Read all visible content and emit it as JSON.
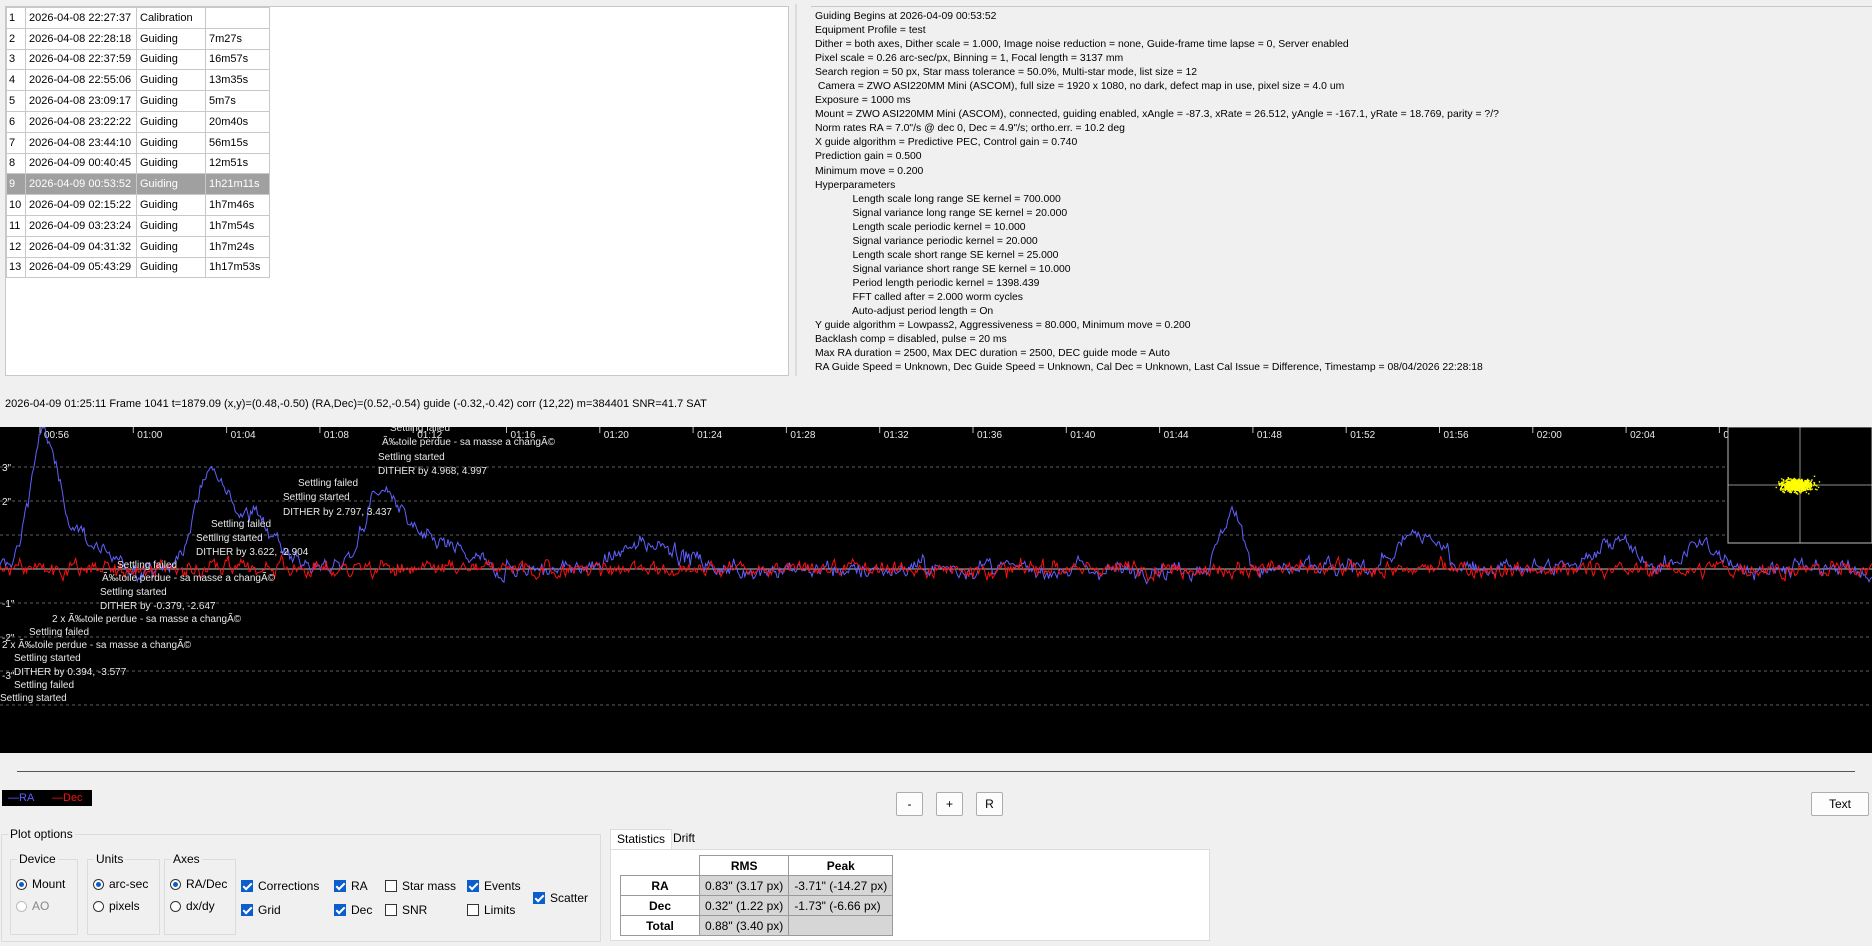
{
  "sessions": [
    {
      "n": "1",
      "date": "2026-04-08 22:27:37",
      "type": "Calibration",
      "dur": ""
    },
    {
      "n": "2",
      "date": "2026-04-08 22:28:18",
      "type": "Guiding",
      "dur": "7m27s"
    },
    {
      "n": "3",
      "date": "2026-04-08 22:37:59",
      "type": "Guiding",
      "dur": "16m57s"
    },
    {
      "n": "4",
      "date": "2026-04-08 22:55:06",
      "type": "Guiding",
      "dur": "13m35s"
    },
    {
      "n": "5",
      "date": "2026-04-08 23:09:17",
      "type": "Guiding",
      "dur": "5m7s"
    },
    {
      "n": "6",
      "date": "2026-04-08 23:22:22",
      "type": "Guiding",
      "dur": "20m40s"
    },
    {
      "n": "7",
      "date": "2026-04-08 23:44:10",
      "type": "Guiding",
      "dur": "56m15s"
    },
    {
      "n": "8",
      "date": "2026-04-09 00:40:45",
      "type": "Guiding",
      "dur": "12m51s"
    },
    {
      "n": "9",
      "date": "2026-04-09 00:53:52",
      "type": "Guiding",
      "dur": "1h21m11s",
      "selected": true
    },
    {
      "n": "10",
      "date": "2026-04-09 02:15:22",
      "type": "Guiding",
      "dur": "1h7m46s"
    },
    {
      "n": "11",
      "date": "2026-04-09 03:23:24",
      "type": "Guiding",
      "dur": "1h7m54s"
    },
    {
      "n": "12",
      "date": "2026-04-09 04:31:32",
      "type": "Guiding",
      "dur": "1h7m24s"
    },
    {
      "n": "13",
      "date": "2026-04-09 05:43:29",
      "type": "Guiding",
      "dur": "1h17m53s"
    }
  ],
  "info_lines": [
    "Guiding Begins at 2026-04-09 00:53:52",
    "Equipment Profile = test",
    "Dither = both axes, Dither scale = 1.000, Image noise reduction = none, Guide-frame time lapse = 0, Server enabled",
    "Pixel scale = 0.26 arc-sec/px, Binning = 1, Focal length = 3137 mm",
    "Search region = 50 px, Star mass tolerance = 50.0%, Multi-star mode, list size = 12",
    " Camera = ZWO ASI220MM Mini (ASCOM), full size = 1920 x 1080, no dark, defect map in use, pixel size = 4.0 um",
    "Exposure = 1000 ms",
    "Mount = ZWO ASI220MM Mini (ASCOM), connected, guiding enabled, xAngle = -87.3, xRate = 26.512, yAngle = -167.1, yRate = 18.769, parity = ?/?",
    "Norm rates RA = 7.0\"/s @ dec 0, Dec = 4.9\"/s; ortho.err. = 10.2 deg",
    "X guide algorithm = Predictive PEC, Control gain = 0.740",
    "Prediction gain = 0.500",
    "Minimum move = 0.200",
    "Hyperparameters",
    "             Length scale long range SE kernel = 700.000",
    "             Signal variance long range SE kernel = 20.000",
    "             Length scale periodic kernel = 10.000",
    "             Signal variance periodic kernel = 20.000",
    "             Length scale short range SE kernel = 25.000",
    "             Signal variance short range SE kernel = 10.000",
    "             Period length periodic kernel = 1398.439",
    "             FFT called after = 2.000 worm cycles",
    "             Auto-adjust period length = On",
    "Y guide algorithm = Lowpass2, Aggressiveness = 80.000, Minimum move = 0.200",
    "Backlash comp = disabled, pulse = 20 ms",
    "Max RA duration = 2500, Max DEC duration = 2500, DEC guide mode = Auto",
    "RA Guide Speed = Unknown, Dec Guide Speed = Unknown, Cal Dec = Unknown, Last Cal Issue = Difference, Timestamp = 08/04/2026 22:28:18"
  ],
  "status_line": "2026-04-09 01:25:11 Frame 1041 t=1879.09 (x,y)=(0.48,-0.50) (RA,Dec)=(0.52,-0.54) guide (-0.32,-0.42) corr (12,22) m=384401 SNR=41.7 SAT",
  "graph": {
    "time_ticks": [
      "00:56",
      "01:00",
      "01:04",
      "01:08",
      "01:12",
      "01:16",
      "01:20",
      "01:24",
      "01:28",
      "01:32",
      "01:36",
      "01:40",
      "01:44",
      "01:48",
      "01:52",
      "01:56",
      "02:00",
      "02:04",
      "0"
    ],
    "y_ticks": [
      "3\"",
      "2\"",
      "-1\"",
      "-2\"",
      "-3\""
    ],
    "events": [
      {
        "text": "Settling failed"
      },
      {
        "text": "Ã‰toile perdue - sa masse a changÃ©"
      },
      {
        "text": "Settling started"
      },
      {
        "text": "DITHER by 4.968, 4.997"
      },
      {
        "text": "Settling failed"
      },
      {
        "text": "Settling started"
      },
      {
        "text": "DITHER by 2.797, 3.437"
      },
      {
        "text": "Settling failed"
      },
      {
        "text": "Settling started"
      },
      {
        "text": "DITHER by 3.622, -2.904"
      },
      {
        "text": "Settling failed"
      },
      {
        "text": "Ã‰toile perdue - sa masse a changÃ©"
      },
      {
        "text": "Settling started"
      },
      {
        "text": "DITHER by -0.379, -2.647"
      },
      {
        "text": "2 x Ã‰toile perdue - sa masse a changÃ©"
      },
      {
        "text": "Settling failed"
      },
      {
        "text": "2 x Ã‰toile perdue - sa masse a changÃ©"
      },
      {
        "text": "Settling started"
      },
      {
        "text": "DITHER by 0.394, -3.577"
      },
      {
        "text": "Settling failed"
      },
      {
        "text": "Settling started"
      }
    ],
    "colors": {
      "ra": "#6060ff",
      "dec": "#ff1010",
      "scatter": "#ffff00",
      "text": "#e8e8e8",
      "grid": "#808080"
    }
  },
  "legend": {
    "ra": "—RA",
    "dec": "—Dec"
  },
  "buttons": {
    "minus": "-",
    "plus": "+",
    "reset": "R",
    "text": "Text"
  },
  "plot_options": {
    "title": "Plot options",
    "device": {
      "title": "Device",
      "mount": "Mount",
      "ao": "AO"
    },
    "units": {
      "title": "Units",
      "arcsec": "arc-sec",
      "pixels": "pixels"
    },
    "axes": {
      "title": "Axes",
      "radec": "RA/Dec",
      "dxdy": "dx/dy"
    },
    "checks": {
      "corrections": "Corrections",
      "grid": "Grid",
      "ra": "RA",
      "dec": "Dec",
      "star_mass": "Star mass",
      "snr": "SNR",
      "events": "Events",
      "limits": "Limits",
      "scatter": "Scatter"
    }
  },
  "statistics": {
    "tabs": [
      "Statistics",
      "Drift"
    ],
    "headers": [
      "RMS",
      "Peak"
    ],
    "rows": [
      {
        "label": "RA",
        "rms": "0.83\" (3.17 px)",
        "peak": "-3.71\" (-14.27 px)"
      },
      {
        "label": "Dec",
        "rms": "0.32\" (1.22 px)",
        "peak": "-1.73\" (-6.66 px)"
      },
      {
        "label": "Total",
        "rms": "0.88\" (3.40 px)",
        "peak": ""
      }
    ]
  }
}
